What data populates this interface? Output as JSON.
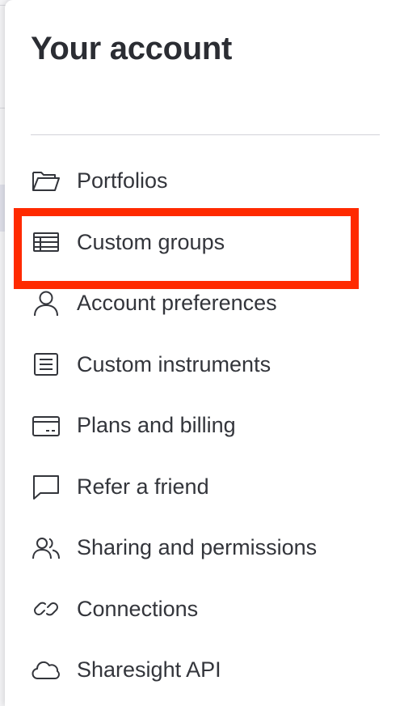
{
  "panel": {
    "title": "Your account"
  },
  "menu": {
    "items": [
      {
        "label": "Portfolios",
        "icon": "folder-icon"
      },
      {
        "label": "Custom groups",
        "icon": "table-icon"
      },
      {
        "label": "Account preferences",
        "icon": "user-icon"
      },
      {
        "label": "Custom instruments",
        "icon": "document-list-icon"
      },
      {
        "label": "Plans and billing",
        "icon": "credit-card-icon"
      },
      {
        "label": "Refer a friend",
        "icon": "chat-bubble-icon"
      },
      {
        "label": "Sharing and permissions",
        "icon": "users-icon"
      },
      {
        "label": "Connections",
        "icon": "link-icon"
      },
      {
        "label": "Sharesight API",
        "icon": "cloud-icon"
      }
    ]
  },
  "colors": {
    "highlight": "#ff2a00",
    "text": "#33353b",
    "title": "#2b2d33",
    "divider": "#d3d3d8"
  }
}
